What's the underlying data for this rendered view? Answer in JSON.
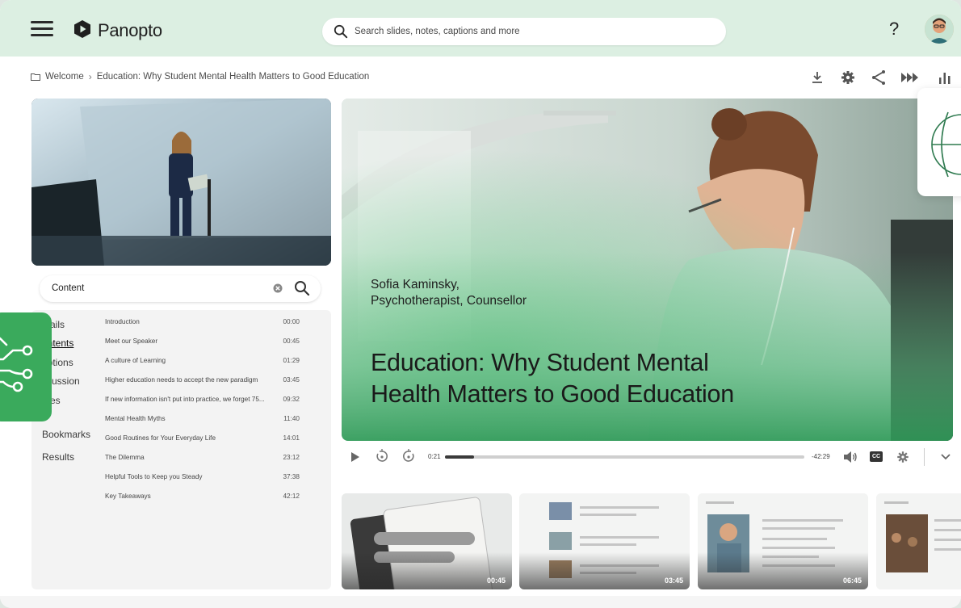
{
  "brand": {
    "name": "Panopto"
  },
  "search": {
    "placeholder": "Search slides, notes, captions and more"
  },
  "header": {
    "help_label": "?"
  },
  "breadcrumb": {
    "root": "Welcome",
    "current": "Education: Why Student Mental Health Matters to Good Education"
  },
  "toolbar": {
    "icons": [
      "download-icon",
      "settings-icon",
      "share-icon",
      "speed-icon",
      "stats-icon"
    ]
  },
  "content_search": {
    "label": "Content"
  },
  "sidebar": {
    "tabs": [
      {
        "label": "etails"
      },
      {
        "label": "ontents",
        "active": true
      },
      {
        "label": "aptions"
      },
      {
        "label": "scussion"
      },
      {
        "label": "otes"
      },
      {
        "label": "Bookmarks"
      },
      {
        "label": "Results"
      }
    ]
  },
  "toc": [
    {
      "title": "Introduction",
      "time": "00:00"
    },
    {
      "title": "Meet our Speaker",
      "time": "00:45"
    },
    {
      "title": "A culture of Learning",
      "time": "01:29"
    },
    {
      "title": "Higher education needs to accept the new paradigm",
      "time": "03:45"
    },
    {
      "title": "If new information isn't put into practice, we forget 75...",
      "time": "09:32"
    },
    {
      "title": "Mental Health Myths",
      "time": "11:40"
    },
    {
      "title": "Good Routines for Your Everyday Life",
      "time": "14:01"
    },
    {
      "title": "The Dilemma",
      "time": "23:12"
    },
    {
      "title": "Helpful Tools to Keep you Steady",
      "time": "37:38"
    },
    {
      "title": "Key Takeaways",
      "time": "42:12"
    }
  ],
  "video": {
    "speaker_name": "Sofia Kaminsky,",
    "speaker_role": "Psychotherapist, Counsellor",
    "title_line1": "Education: Why Student Mental",
    "title_line2": "Health Matters to Good Education"
  },
  "player": {
    "current_time": "0:21",
    "remaining_time": "-42:29",
    "progress": 0.08,
    "cc_label": "CC"
  },
  "thumbnails": [
    {
      "duration": "00:45"
    },
    {
      "duration": "03:45"
    },
    {
      "duration": "06:45"
    },
    {
      "duration": ""
    }
  ],
  "colors": {
    "header_bg": "#dcefe2",
    "accent_green": "#3aaa5c",
    "panel_bg": "#f3f3f3"
  }
}
